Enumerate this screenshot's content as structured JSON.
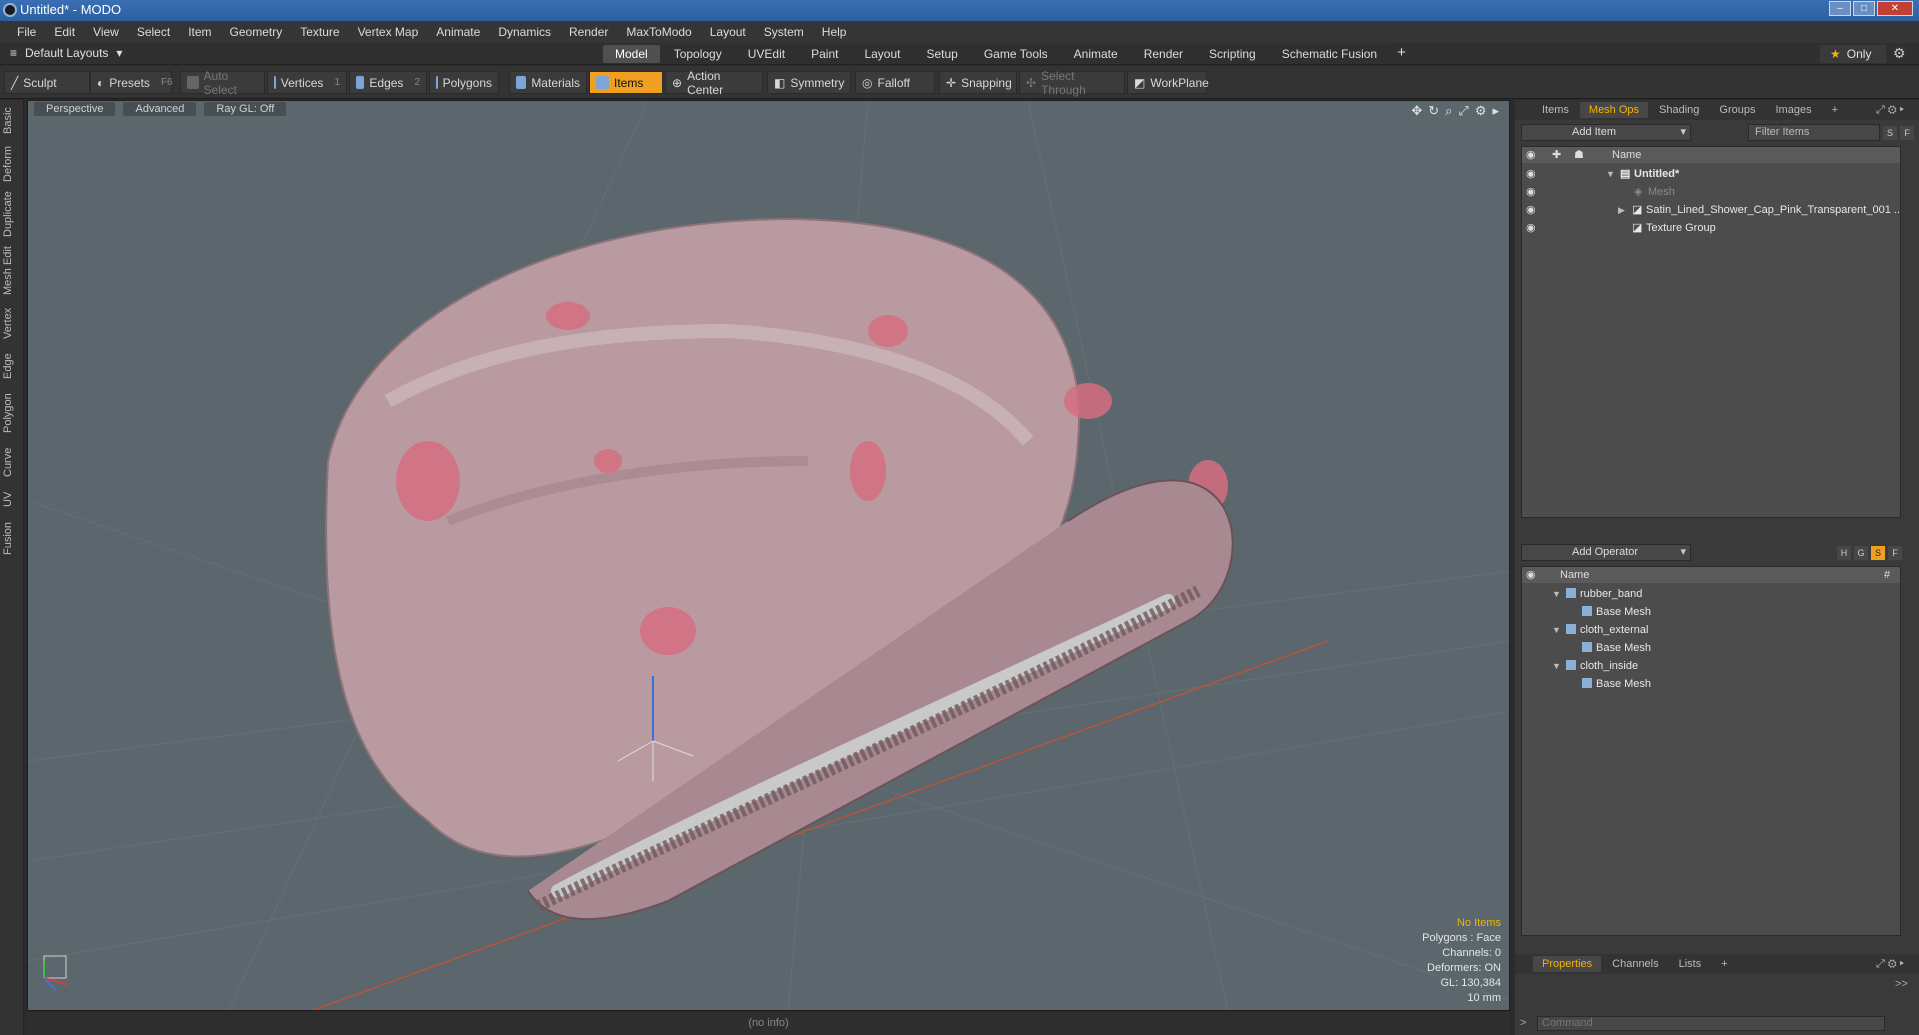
{
  "window": {
    "title": "Untitled* - MODO"
  },
  "menu": [
    "File",
    "Edit",
    "View",
    "Select",
    "Item",
    "Geometry",
    "Texture",
    "Vertex Map",
    "Animate",
    "Dynamics",
    "Render",
    "MaxToModo",
    "Layout",
    "System",
    "Help"
  ],
  "layout": {
    "selector": "Default Layouts",
    "tabs": [
      "Model",
      "Topology",
      "UVEdit",
      "Paint",
      "Layout",
      "Setup",
      "Game Tools",
      "Animate",
      "Render",
      "Scripting",
      "Schematic Fusion"
    ],
    "active_tab": "Model",
    "only_label": "Only"
  },
  "toolbar": {
    "sculpt": "Sculpt",
    "presets": "Presets",
    "presets_key": "F6",
    "auto_select": "Auto Select",
    "vertices": "Vertices",
    "vertices_key": "1",
    "edges": "Edges",
    "edges_key": "2",
    "polygons": "Polygons",
    "materials": "Materials",
    "items": "Items",
    "action_center": "Action Center",
    "symmetry": "Symmetry",
    "falloff": "Falloff",
    "snapping": "Snapping",
    "select_through": "Select Through",
    "workplane": "WorkPlane"
  },
  "left_tabs": [
    "Basic",
    "Deform",
    "Duplicate",
    "Mesh Edit",
    "Vertex",
    "Edge",
    "Polygon",
    "Curve",
    "UV",
    "Fusion"
  ],
  "viewport": {
    "view": "Perspective",
    "shading": "Advanced",
    "raygl": "Ray GL: Off",
    "info": {
      "selection": "No Items",
      "polygons": "Polygons : Face",
      "channels": "Channels: 0",
      "deformers": "Deformers: ON",
      "gl": "GL: 130,384",
      "unit": "10 mm"
    }
  },
  "status": "(no info)",
  "items_panel": {
    "tabs": [
      "Items",
      "Mesh Ops",
      "Shading",
      "Groups",
      "Images"
    ],
    "active_tab": "Mesh Ops",
    "add_item": "Add Item",
    "filter": "Filter Items",
    "column": "Name",
    "tree": [
      {
        "label": "Untitled*"
      },
      {
        "label": "Mesh"
      },
      {
        "label": "Satin_Lined_Shower_Cap_Pink_Transparent_001 ..."
      },
      {
        "label": "Texture Group"
      }
    ]
  },
  "meshops_panel": {
    "add_operator": "Add Operator",
    "column": "Name",
    "column_hash": "#",
    "tree": [
      {
        "label": "rubber_band"
      },
      {
        "label": "Base Mesh"
      },
      {
        "label": "cloth_external"
      },
      {
        "label": "Base Mesh"
      },
      {
        "label": "cloth_inside"
      },
      {
        "label": "Base Mesh"
      }
    ]
  },
  "bottom_panel": {
    "tabs": [
      "Properties",
      "Channels",
      "Lists"
    ],
    "active_tab": "Properties",
    "command_placeholder": "Command"
  }
}
